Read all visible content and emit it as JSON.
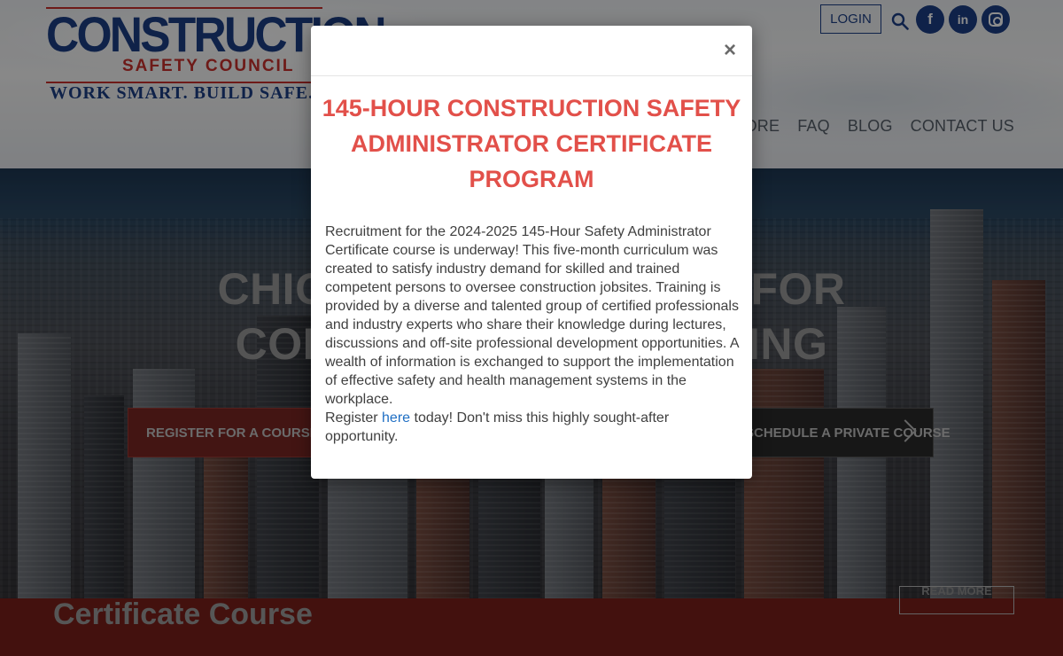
{
  "header": {
    "logo": {
      "word": "CONSTRUCTION",
      "sub": "SAFETY COUNCIL",
      "tagline": "WORK SMART. BUILD SAFE."
    },
    "login_label": "LOGIN",
    "social": {
      "facebook": "f",
      "linkedin": "in"
    },
    "nav": [
      "STORE",
      "FAQ",
      "BLOG",
      "CONTACT US"
    ]
  },
  "hero": {
    "title_line1": "CHICAGO'S RESOURCE FOR",
    "title_line2": "CONSTRUCTION TRAINING",
    "register_button": "REGISTER FOR A COURSE",
    "private_button": "SCHEDULE A PRIVATE COURSE"
  },
  "band": {
    "title": "Certificate Course",
    "read_more": "READ MORE"
  },
  "modal": {
    "close": "×",
    "title": "145-HOUR CONSTRUCTION SAFETY ADMINISTRATOR CERTIFICATE PROGRAM",
    "body": "Recruitment for the 2024-2025 145-Hour Safety Administrator Certificate course is underway! This five-month curriculum was created to satisfy industry demand for skilled and trained competent persons to oversee construction jobsites. Training is provided by a diverse and talented group of certified professionals and industry experts who share their knowledge during lectures, discussions and off-site professional development opportunities. A wealth of information is exchanged to support the implementation of effective safety and health management systems in the workplace.",
    "register_prefix": "Register ",
    "register_link": "here",
    "register_suffix": " today! Don't miss this highly sought-after opportunity."
  },
  "colors": {
    "brand_blue": "#1d3f86",
    "brand_red": "#c9302c",
    "modal_title": "#e2504a",
    "link": "#1f6fc4",
    "band": "#7a1f1b"
  },
  "icons": [
    "search-icon",
    "facebook-icon",
    "linkedin-icon",
    "instagram-icon",
    "close-icon",
    "chevron-right-icon"
  ]
}
